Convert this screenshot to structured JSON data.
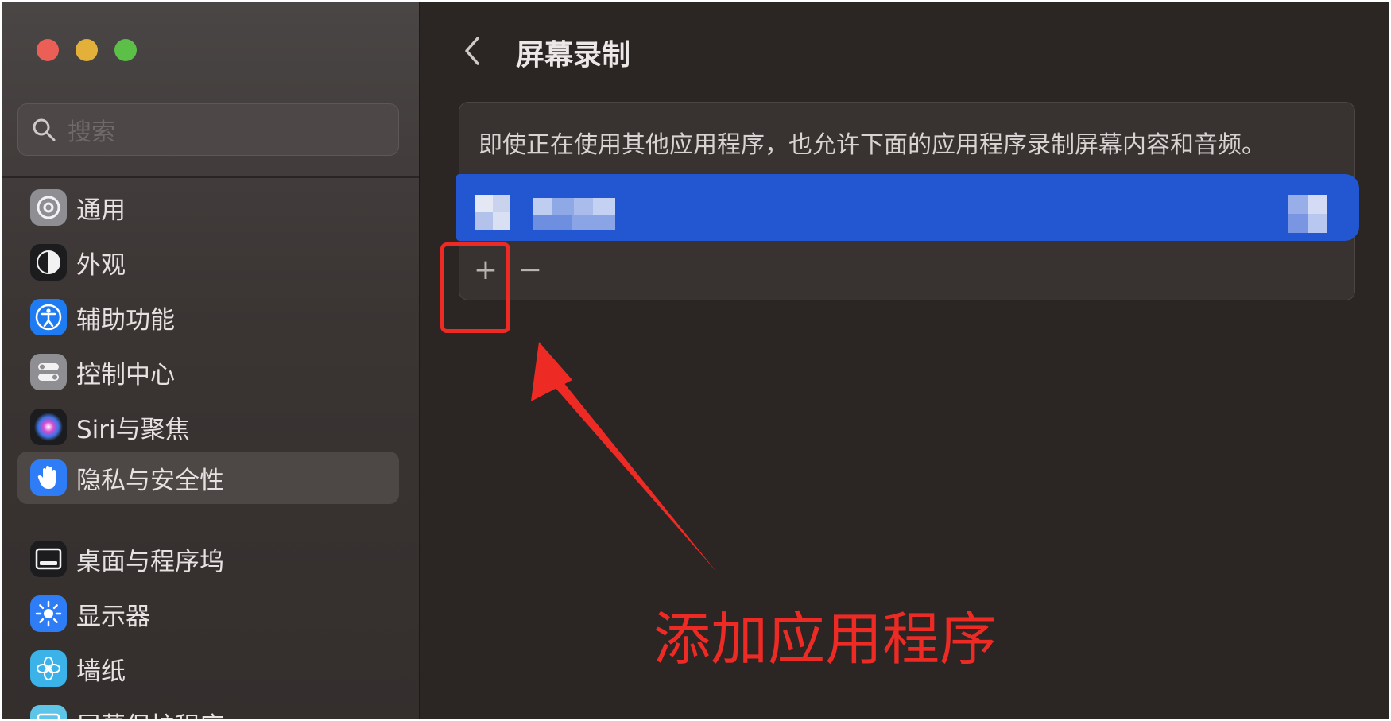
{
  "sidebar": {
    "search_placeholder": "搜索",
    "items": [
      {
        "label": "通用",
        "icon": "gear-icon",
        "color": "#8e8e93"
      },
      {
        "label": "外观",
        "icon": "appearance-icon",
        "color": "#1c1c1e"
      },
      {
        "label": "辅助功能",
        "icon": "accessibility-icon",
        "color": "#1e7bf2"
      },
      {
        "label": "控制中心",
        "icon": "control-center-icon",
        "color": "#8e8e93"
      },
      {
        "label": "Siri与聚焦",
        "icon": "siri-icon",
        "color": "#6a3cc9"
      },
      {
        "label": "隐私与安全性",
        "icon": "hand-icon",
        "color": "#2e7cf6"
      },
      {
        "label": "桌面与程序坞",
        "icon": "dock-icon",
        "color": "#1c1c1e"
      },
      {
        "label": "显示器",
        "icon": "display-brightness-icon",
        "color": "#2e7cf6"
      },
      {
        "label": "墙纸",
        "icon": "wallpaper-icon",
        "color": "#3bb2e8"
      },
      {
        "label": "屏幕保护程序",
        "icon": "screensaver-icon",
        "color": "#5ec4e8"
      }
    ],
    "selected_index": 5
  },
  "main": {
    "title": "屏幕录制",
    "description": "即使正在使用其他应用程序，也允许下面的应用程序录制屏幕内容和音频。",
    "add_label": "+",
    "remove_label": "−"
  },
  "annotation": {
    "text": "添加应用程序",
    "color": "#ee2a24"
  },
  "colors": {
    "selection_blue": "#2357d2",
    "window_bg": "#2b2524"
  }
}
